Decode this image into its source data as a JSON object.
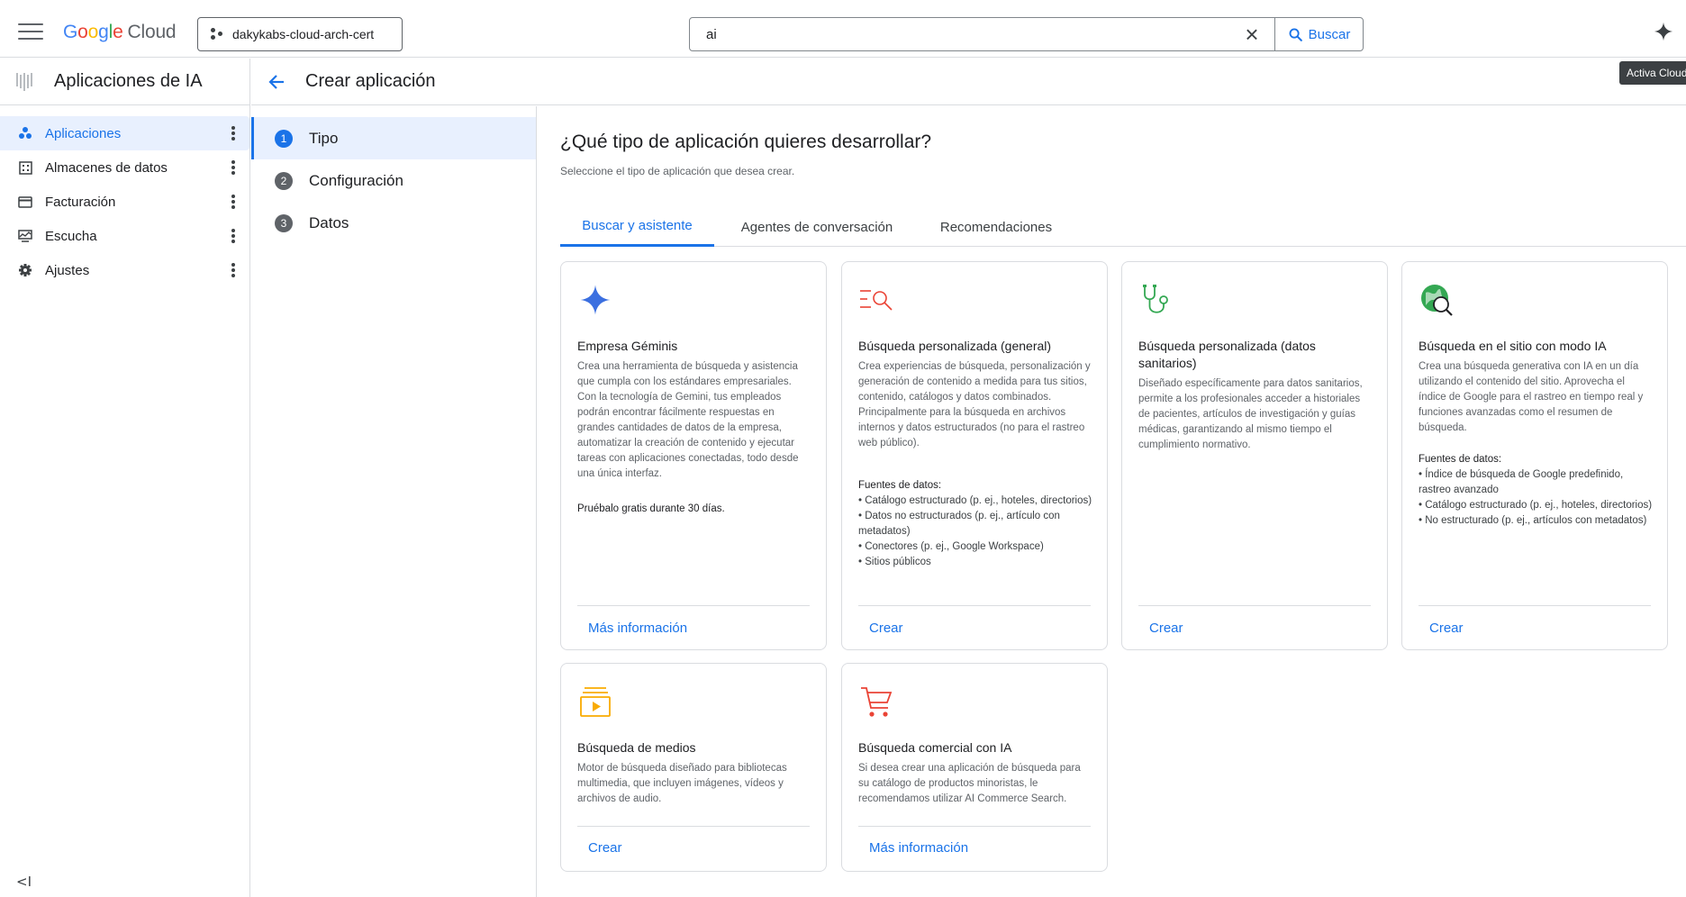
{
  "topbar": {
    "logo": {
      "g1": "G",
      "o1": "o",
      "o2": "o",
      "g2": "g",
      "l": "l",
      "e": "e",
      "cloud": "Cloud"
    },
    "project": "dakykabs-cloud-arch-cert",
    "search_query": "ai",
    "search_button": "Buscar",
    "tooltip": "Activa Cloud"
  },
  "sidebar": {
    "title": "Aplicaciones de IA",
    "items": [
      {
        "label": "Aplicaciones",
        "icon": "apps-icon"
      },
      {
        "label": "Almacenes de datos",
        "icon": "datastore-icon"
      },
      {
        "label": "Facturación",
        "icon": "billing-icon"
      },
      {
        "label": "Escucha",
        "icon": "monitor-icon"
      },
      {
        "label": "Ajustes",
        "icon": "gear-icon"
      }
    ],
    "collapse": "<I"
  },
  "header": {
    "title": "Crear aplicación"
  },
  "stepper": {
    "steps": [
      {
        "num": "1",
        "label": "Tipo"
      },
      {
        "num": "2",
        "label": "Configuración"
      },
      {
        "num": "3",
        "label": "Datos"
      }
    ]
  },
  "main": {
    "title": "¿Qué tipo de aplicación quieres desarrollar?",
    "subtitle": "Seleccione el tipo de aplicación que desea crear.",
    "tabs": [
      "Buscar y asistente",
      "Agentes de conversación",
      "Recomendaciones"
    ]
  },
  "cards": [
    {
      "title": "Empresa Géminis",
      "desc": "Crea una herramienta de búsqueda y asistencia que cumpla con los estándares empresariales. Con la tecnología de Gemini, tus empleados podrán encontrar fácilmente respuestas en grandes cantidades de datos de la empresa, automatizar la creación de contenido y ejecutar tareas con aplicaciones conectadas, todo desde una única interfaz.",
      "extra": "Pruébalo gratis durante 30 días.",
      "action": "Más información"
    },
    {
      "title": "Búsqueda personalizada (general)",
      "desc": "Crea experiencias de búsqueda, personalización y generación de contenido a medida para tus sitios, contenido, catálogos y datos combinados. Principalmente para la búsqueda en archivos internos y datos estructurados (no para el rastreo web público).",
      "sources_heading": "Fuentes de datos:",
      "sources": [
        "• Catálogo estructurado (p. ej., hoteles, directorios)",
        "• Datos no estructurados (p. ej., artículo con metadatos)",
        "• Conectores (p. ej., Google Workspace)",
        "• Sitios públicos"
      ],
      "action": "Crear"
    },
    {
      "title": "Búsqueda personalizada (datos sanitarios)",
      "desc": "Diseñado específicamente para datos sanitarios, permite a los profesionales acceder a historiales de pacientes, artículos de investigación y guías médicas, garantizando al mismo tiempo el cumplimiento normativo.",
      "action": "Crear"
    },
    {
      "title": "Búsqueda en el sitio con modo IA",
      "desc": "Crea una búsqueda generativa con IA en un día utilizando el contenido del sitio. Aprovecha el índice de Google para el rastreo en tiempo real y funciones avanzadas como el resumen de búsqueda.",
      "sources_heading": "Fuentes de datos:",
      "sources": [
        "• Índice de búsqueda de Google predefinido, rastreo avanzado",
        "• Catálogo estructurado (p. ej., hoteles, directorios)",
        "• No estructurado (p. ej., artículos con metadatos)"
      ],
      "action": "Crear"
    },
    {
      "title": "Búsqueda de medios",
      "desc": "Motor de búsqueda diseñado para bibliotecas multimedia, que incluyen imágenes, vídeos y archivos de audio.",
      "action": "Crear"
    },
    {
      "title": "Búsqueda comercial con IA",
      "desc": "Si desea crear una aplicación de búsqueda para su catálogo de productos minoristas, le recomendamos utilizar AI Commerce Search.",
      "action": "Más información"
    }
  ],
  "colors": {
    "accent": "#1a73e8",
    "active_bg": "#e8f0fe",
    "red_icon": "#ea4335",
    "green_icon": "#34a853",
    "yellow_icon": "#f9ab00"
  }
}
